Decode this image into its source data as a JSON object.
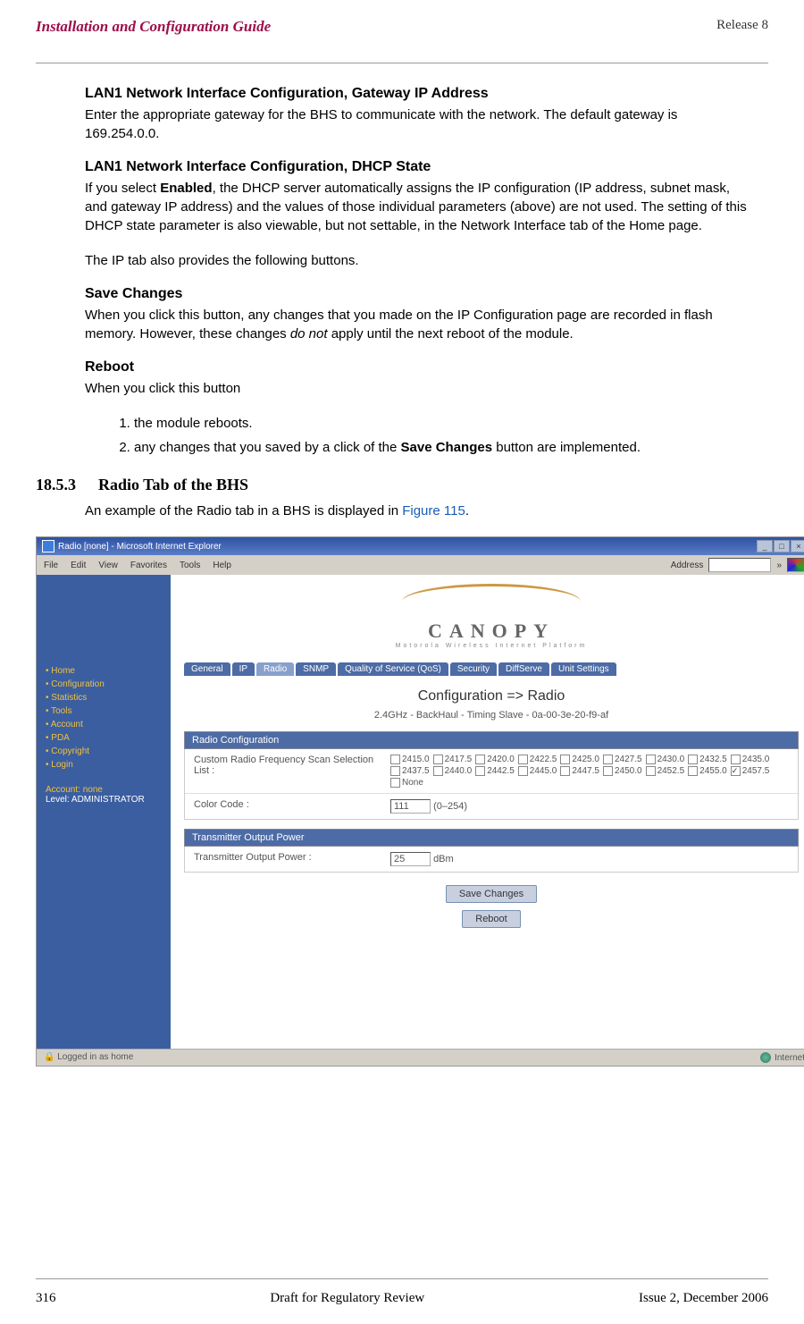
{
  "header": {
    "left": "Installation and Configuration Guide",
    "right": "Release 8"
  },
  "sections": {
    "lan1_gateway": {
      "heading": "LAN1 Network Interface Configuration, Gateway IP Address",
      "text": "Enter the appropriate gateway for the BHS to communicate with the network. The default gateway is 169.254.0.0."
    },
    "lan1_dhcp": {
      "heading": "LAN1 Network Interface Configuration, DHCP State",
      "text_pre": "If you select ",
      "enabled": "Enabled",
      "text_post": ", the DHCP server automatically assigns the IP configuration (IP address, subnet mask, and gateway IP address) and the values of those individual parameters (above) are not used. The setting of this DHCP state parameter is also viewable, but not settable, in the Network Interface tab of the Home page."
    },
    "ip_tab_text": "The IP tab also provides the following buttons.",
    "save_changes": {
      "heading": "Save Changes",
      "text_pre": "When you click this button, any changes that you made on the IP Configuration page are recorded in flash memory. However, these changes ",
      "donot": "do not",
      "text_post": " apply until the next reboot of the module."
    },
    "reboot": {
      "heading": "Reboot",
      "text": "When you click this button",
      "list": [
        "the module reboots.",
        "any changes that you saved by a click of the Save Changes button are implemented."
      ],
      "save_changes_bold": "Save Changes"
    },
    "section_1853": {
      "number": "18.5.3",
      "title": "Radio Tab of the BHS",
      "text_pre": "An example of the Radio tab in a BHS is displayed in ",
      "link": "Figure 115",
      "text_post": "."
    }
  },
  "screenshot": {
    "window_title": "Radio [none] - Microsoft Internet Explorer",
    "minimize": "_",
    "maximize": "□",
    "close": "×",
    "menubar": [
      "File",
      "Edit",
      "View",
      "Favorites",
      "Tools",
      "Help"
    ],
    "address_label": "Address",
    "sidebar": {
      "items": [
        "Home",
        "Configuration",
        "Statistics",
        "Tools",
        "Account",
        "PDA",
        "Copyright",
        "Login"
      ],
      "account_label": "Account: none",
      "level_label": "Level: ADMINISTRATOR"
    },
    "logo": {
      "text": "CANOPY",
      "sub": "Motorola Wireless Internet Platform"
    },
    "tabs": [
      "General",
      "IP",
      "Radio",
      "SNMP",
      "Quality of Service (QoS)",
      "Security",
      "DiffServe",
      "Unit Settings"
    ],
    "active_tab_index": 2,
    "config_title": "Configuration => Radio",
    "config_sub": "2.4GHz - BackHaul - Timing Slave - 0a-00-3e-20-f9-af",
    "panels": {
      "radio_config": {
        "title": "Radio Configuration",
        "rows": [
          {
            "label": "Custom Radio Frequency Scan Selection List :",
            "frequencies": [
              "2415.0",
              "2417.5",
              "2420.0",
              "2422.5",
              "2425.0",
              "2427.5",
              "2430.0",
              "2432.5",
              "2435.0",
              "2437.5",
              "2440.0",
              "2442.5",
              "2445.0",
              "2447.5",
              "2450.0",
              "2452.5",
              "2455.0",
              "2457.5",
              "None"
            ],
            "checked": [
              "2457.5"
            ]
          },
          {
            "label": "Color Code :",
            "value": "111",
            "range": "(0–254)"
          }
        ]
      },
      "tx_power": {
        "title": "Transmitter Output Power",
        "label": "Transmitter Output Power :",
        "value": "25",
        "unit": "dBm"
      }
    },
    "buttons": {
      "save": "Save Changes",
      "reboot": "Reboot"
    },
    "status": {
      "left": "Logged in as home",
      "right": "Internet"
    }
  },
  "footer": {
    "page": "316",
    "center": "Draft for Regulatory Review",
    "right": "Issue 2, December 2006"
  }
}
